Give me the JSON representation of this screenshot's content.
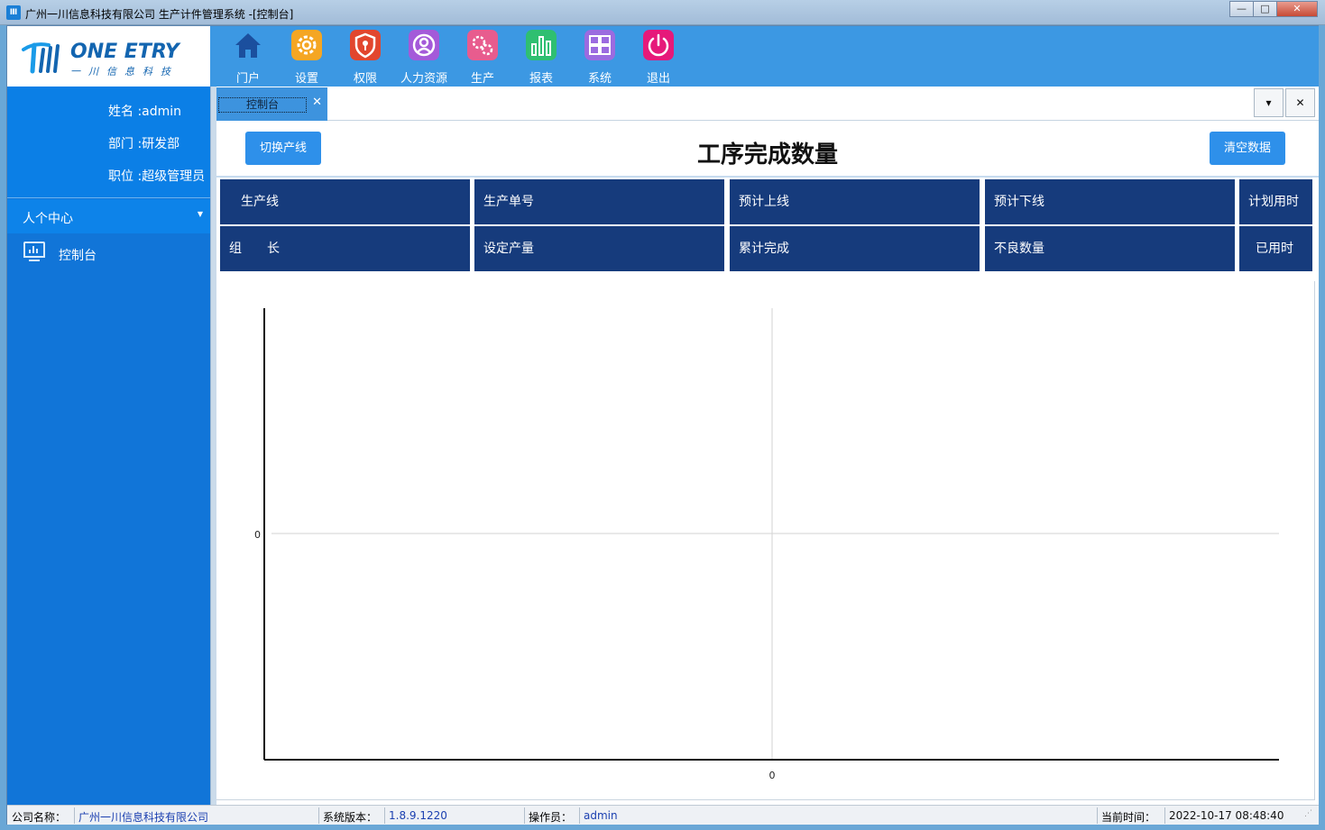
{
  "window": {
    "title": "广州一川信息科技有限公司 生产计件管理系统 -[控制台]",
    "buttons": {
      "minimize": "—",
      "maximize": "□",
      "close": "✕"
    }
  },
  "logo": {
    "brand": "ONE ETRY",
    "sub": "一川信息科技"
  },
  "toolbar": {
    "items": [
      {
        "label": "门户",
        "icon": "home-icon",
        "color": "#1b4f9e"
      },
      {
        "label": "设置",
        "icon": "gear-icon",
        "color": "#f5a623"
      },
      {
        "label": "权限",
        "icon": "shield-icon",
        "color": "#e2462e"
      },
      {
        "label": "人力资源",
        "icon": "user-icon",
        "color": "#a45ad9"
      },
      {
        "label": "生产",
        "icon": "cogs-icon",
        "color": "#e85c8e"
      },
      {
        "label": "报表",
        "icon": "bar-chart-icon",
        "color": "#2fbf71"
      },
      {
        "label": "系统",
        "icon": "windows-icon",
        "color": "#9b6be0"
      },
      {
        "label": "退出",
        "icon": "power-icon",
        "color": "#e6197a"
      }
    ]
  },
  "user": {
    "name": "姓名 :admin",
    "dept": "部门 :研发部",
    "position": "职位 :超级管理员"
  },
  "sidebar": {
    "group_label": "人个中心",
    "group_caret": "▼",
    "items": [
      {
        "label": "控制台",
        "icon": "monitor-chart-icon"
      }
    ]
  },
  "tabs": {
    "items": [
      {
        "label": "控制台",
        "close": "✕"
      }
    ],
    "dropdown": "▾",
    "close_all": "✕"
  },
  "header": {
    "switch_line": "切换产线",
    "title": "工序完成数量",
    "clear_data": "清空数据"
  },
  "info_grid": {
    "row1": [
      "生产线",
      "生产单号",
      "预计上线",
      "预计下线",
      "计划用时"
    ],
    "row2": [
      "组　　长",
      "设定产量",
      "累计完成",
      "不良数量",
      "已用时"
    ]
  },
  "chart_data": {
    "type": "bar",
    "categories": [],
    "values": [],
    "title": "",
    "xlabel": "",
    "ylabel": "",
    "ytick_labels": [
      "0"
    ],
    "xtick_labels": [
      "0"
    ],
    "grid": true
  },
  "status": {
    "company_label": "公司名称：",
    "company_value": "广州一川信息科技有限公司",
    "version_label": "系统版本：",
    "version_value": "1.8.9.1220",
    "operator_label": "操作员：",
    "operator_value": "admin",
    "time_label": "当前时间：",
    "time_value": "2022-10-17 08:48:40"
  }
}
